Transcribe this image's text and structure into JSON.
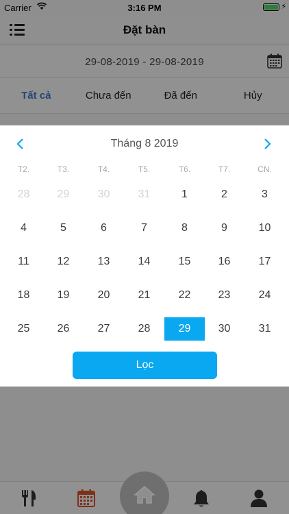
{
  "status": {
    "carrier": "Carrier",
    "time": "3:16 PM"
  },
  "header": {
    "title": "Đặt bàn",
    "menu_icon": "list-menu-icon"
  },
  "date_range": {
    "text": "29-08-2019 - 29-08-2019",
    "icon": "calendar-icon"
  },
  "tabs": [
    {
      "label": "Tất cả",
      "active": true
    },
    {
      "label": "Chưa đến",
      "active": false
    },
    {
      "label": "Đã đến",
      "active": false
    },
    {
      "label": "Hủy",
      "active": false
    }
  ],
  "calendar": {
    "month_label": "Tháng 8 2019",
    "weekdays": [
      "T2.",
      "T3.",
      "T4.",
      "T5.",
      "T6.",
      "T7.",
      "CN."
    ],
    "weeks": [
      [
        "28",
        "29",
        "30",
        "31",
        "1",
        "2",
        "3"
      ],
      [
        "4",
        "5",
        "6",
        "7",
        "8",
        "9",
        "10"
      ],
      [
        "11",
        "12",
        "13",
        "14",
        "15",
        "16",
        "17"
      ],
      [
        "18",
        "19",
        "20",
        "21",
        "22",
        "23",
        "24"
      ],
      [
        "25",
        "26",
        "27",
        "28",
        "29",
        "30",
        "31"
      ]
    ],
    "muted_cells": [
      [
        0,
        0
      ],
      [
        0,
        1
      ],
      [
        0,
        2
      ],
      [
        0,
        3
      ]
    ],
    "selected_cell": [
      4,
      4
    ],
    "filter_label": "Lọc",
    "accent_color": "#0aa8f0"
  },
  "bottom_tabs": [
    {
      "name": "restaurant-icon",
      "active": false
    },
    {
      "name": "calendar-icon",
      "active": true,
      "color": "#d9532c"
    },
    {
      "name": "home-icon",
      "active": false
    },
    {
      "name": "bell-icon",
      "active": false
    },
    {
      "name": "user-icon",
      "active": false
    }
  ]
}
